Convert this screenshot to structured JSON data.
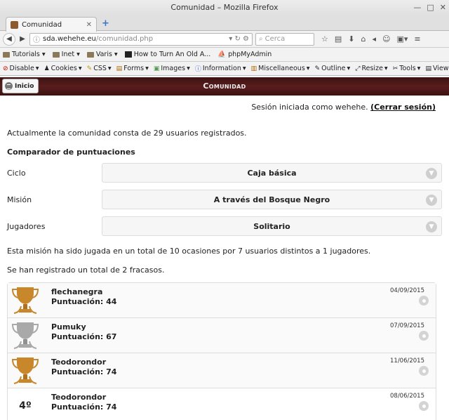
{
  "browser": {
    "window_title": "Comunidad – Mozilla Firefox",
    "tab_title": "Comunidad",
    "url_host": "sda.wehehe.eu",
    "url_path": "/comunidad.php",
    "search_placeholder": "Cerca"
  },
  "bookmarks": [
    {
      "label": "Tutorials",
      "icon": "folder-icon"
    },
    {
      "label": "Inet",
      "icon": "folder-icon"
    },
    {
      "label": "Varis",
      "icon": "folder-icon"
    },
    {
      "label": "How to Turn An Old A...",
      "icon": "page-icon"
    },
    {
      "label": "phpMyAdmin",
      "icon": "php-icon"
    }
  ],
  "devtools": [
    "Disable",
    "Cookies",
    "CSS",
    "Forms",
    "Images",
    "Information",
    "Miscellaneous",
    "Outline",
    "Resize",
    "Tools",
    "View So"
  ],
  "site": {
    "home_button": "Inicio",
    "title": "Comunidad",
    "session_text": "Sesión iniciada como wehehe.",
    "logout_link": "(Cerrar sesión)",
    "community_text": "Actualmente la comunidad consta de 29 usuarios registrados.",
    "comparator_heading": "Comparador de puntuaciones",
    "filters": {
      "ciclo_label": "Ciclo",
      "ciclo_value": "Caja básica",
      "mision_label": "Misión",
      "mision_value": "A través del Bosque Negro",
      "jugadores_label": "Jugadores",
      "jugadores_value": "Solitario"
    },
    "stats_text": "Esta misión ha sido jugada en un total de 10 ocasiones por 7 usuarios distintos a 1 jugadores.",
    "failures_text": "Se han registrado un total de 2 fracasos."
  },
  "ranking": [
    {
      "trophy": "gold-trophy",
      "color": "#c8872a",
      "user": "flechanegra",
      "score": "Puntuación: 44",
      "date": "04/09/2015"
    },
    {
      "trophy": "silver-trophy",
      "color": "#a9a9a9",
      "user": "Pumuky",
      "score": "Puntuación: 67",
      "date": "07/09/2015"
    },
    {
      "trophy": "bronze-trophy",
      "color": "#c8872a",
      "user": "Teodorondor",
      "score": "Puntuación: 74",
      "date": "11/06/2015"
    },
    {
      "place": "4º",
      "user": "Teodorondor",
      "score": "Puntuación: 74",
      "date": "08/06/2015"
    }
  ]
}
